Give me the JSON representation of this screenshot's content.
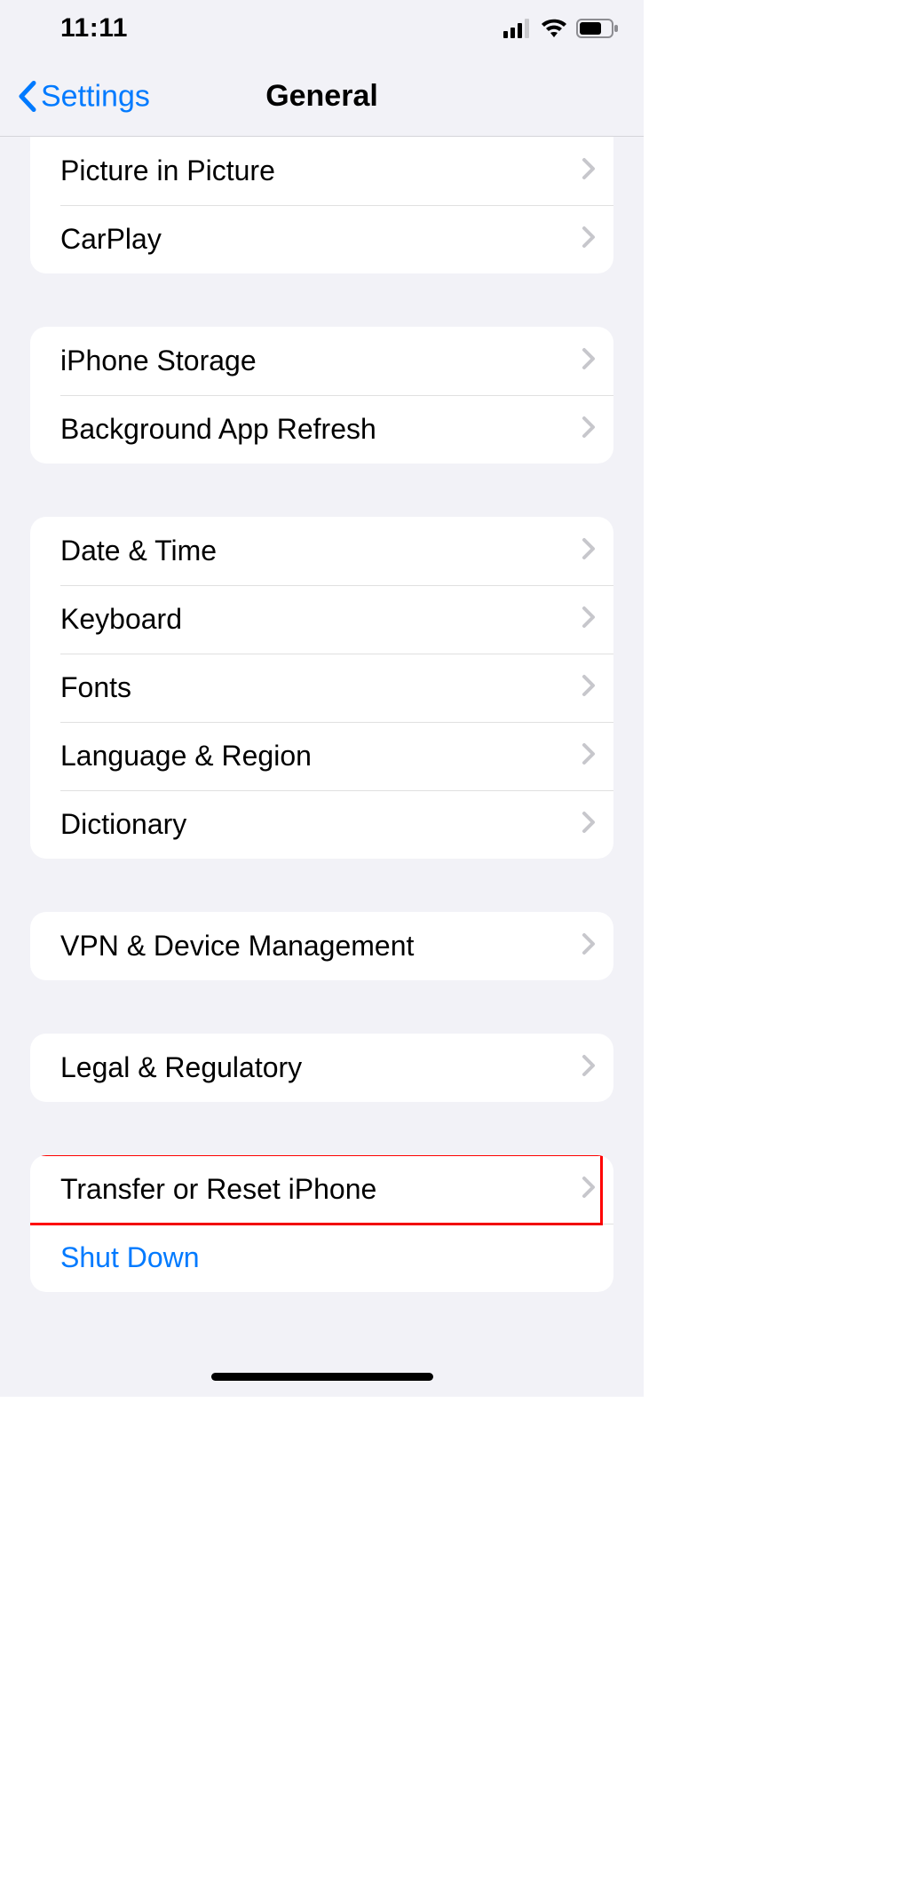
{
  "status": {
    "time": "11:11"
  },
  "nav": {
    "back_label": "Settings",
    "title": "General"
  },
  "groups": [
    {
      "id": "g0",
      "first": true,
      "rows": [
        {
          "id": "pip",
          "label": "Picture in Picture",
          "chevron": true,
          "link": false
        },
        {
          "id": "carplay",
          "label": "CarPlay",
          "chevron": true,
          "link": false
        }
      ]
    },
    {
      "id": "g1",
      "rows": [
        {
          "id": "storage",
          "label": "iPhone Storage",
          "chevron": true,
          "link": false
        },
        {
          "id": "bgrefresh",
          "label": "Background App Refresh",
          "chevron": true,
          "link": false
        }
      ]
    },
    {
      "id": "g2",
      "rows": [
        {
          "id": "datetime",
          "label": "Date & Time",
          "chevron": true,
          "link": false
        },
        {
          "id": "keyboard",
          "label": "Keyboard",
          "chevron": true,
          "link": false
        },
        {
          "id": "fonts",
          "label": "Fonts",
          "chevron": true,
          "link": false
        },
        {
          "id": "langreg",
          "label": "Language & Region",
          "chevron": true,
          "link": false
        },
        {
          "id": "dict",
          "label": "Dictionary",
          "chevron": true,
          "link": false
        }
      ]
    },
    {
      "id": "g3",
      "rows": [
        {
          "id": "vpn",
          "label": "VPN & Device Management",
          "chevron": true,
          "link": false
        }
      ]
    },
    {
      "id": "g4",
      "rows": [
        {
          "id": "legal",
          "label": "Legal & Regulatory",
          "chevron": true,
          "link": false
        }
      ]
    },
    {
      "id": "g5",
      "rows": [
        {
          "id": "transfer",
          "label": "Transfer or Reset iPhone",
          "chevron": true,
          "link": false,
          "highlight": true
        },
        {
          "id": "shutdown",
          "label": "Shut Down",
          "chevron": false,
          "link": true
        }
      ]
    }
  ]
}
